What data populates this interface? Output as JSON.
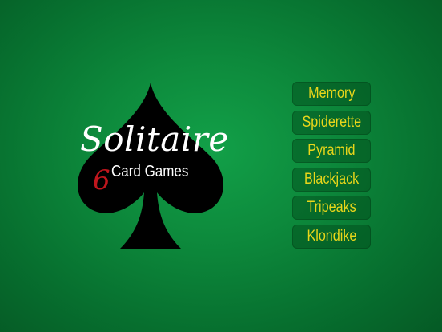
{
  "logo": {
    "icon": "spade-icon",
    "title": "Solitaire",
    "number": "6",
    "subtitle": "Card Games",
    "colors": {
      "spade": "#000000",
      "title": "#ffffff",
      "number": "#c0161d"
    }
  },
  "menu": {
    "items": [
      {
        "label": "Memory"
      },
      {
        "label": "Spiderette"
      },
      {
        "label": "Pyramid"
      },
      {
        "label": "Blackjack"
      },
      {
        "label": "Tripeaks"
      },
      {
        "label": "Klondike"
      }
    ],
    "text_color": "#e9d61a"
  },
  "background_color": "#0d8a3c"
}
